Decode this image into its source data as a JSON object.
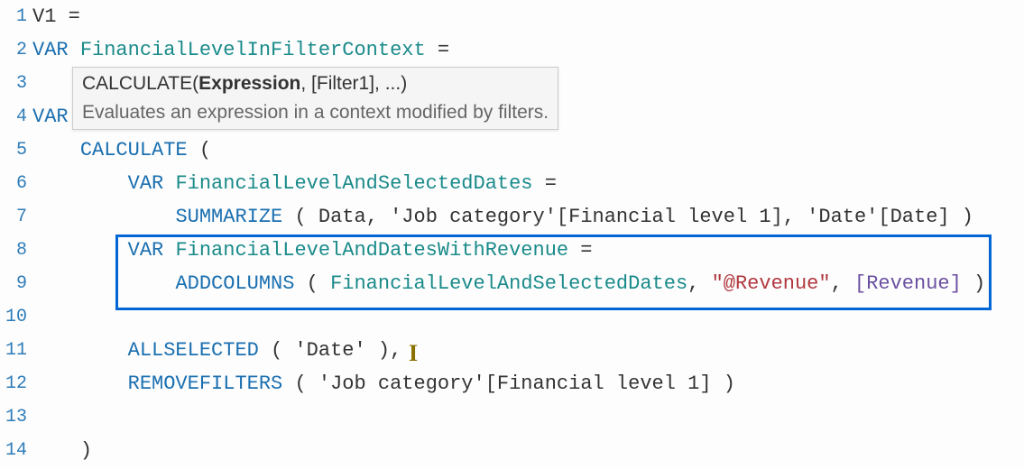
{
  "lines": {
    "l1_num": "1",
    "l1_name": "V1",
    "l1_eq": " =",
    "l2_num": "2",
    "l2_var": "VAR ",
    "l2_id": "FinancialLevelInFilterContext",
    "l2_eq": " =",
    "l3_num": "3",
    "l4_num": "4",
    "l4_var": "VAR ",
    "l5_num": "5",
    "l5_pad": "    ",
    "l5_func": "CALCULATE",
    "l5_paren": " (",
    "l6_num": "6",
    "l6_pad": "        ",
    "l6_var": "VAR ",
    "l6_id": "FinancialLevelAndSelectedDates",
    "l6_eq": " =",
    "l7_num": "7",
    "l7_pad": "            ",
    "l7_func": "SUMMARIZE",
    "l7_open": " ( ",
    "l7_arg1": "Data",
    "l7_c1": ", ",
    "l7_arg2": "'Job category'[Financial level 1]",
    "l7_c2": ", ",
    "l7_arg3": "'Date'[Date]",
    "l7_close": " )",
    "l8_num": "8",
    "l8_pad": "        ",
    "l8_var": "VAR ",
    "l8_id": "FinancialLevelAndDatesWithRevenue",
    "l8_eq": " =",
    "l9_num": "9",
    "l9_pad": "            ",
    "l9_func": "ADDCOLUMNS",
    "l9_open": " ( ",
    "l9_arg1": "FinancialLevelAndSelectedDates",
    "l9_c1": ", ",
    "l9_str": "\"@Revenue\"",
    "l9_c2": ", ",
    "l9_br_open": "[",
    "l9_meas": "Revenue",
    "l9_br_close": "]",
    "l9_close": " )",
    "l10_num": "10",
    "l11_num": "11",
    "l11_pad": "        ",
    "l11_func": "ALLSELECTED",
    "l11_open": " ( ",
    "l11_arg": "'Date'",
    "l11_close": " ),",
    "l12_num": "12",
    "l12_pad": "        ",
    "l12_func": "REMOVEFILTERS",
    "l12_open": " ( ",
    "l12_arg": "'Job category'[Financial level 1]",
    "l12_close": " )",
    "l13_num": "13",
    "l14_num": "14",
    "l14_pad": "    ",
    "l14_close": ")"
  },
  "tooltip": {
    "sig_func": "CALCULATE(",
    "sig_bold": "Expression",
    "sig_rest": ", [Filter1], ...)",
    "desc": "Evaluates an expression in a context modified by filters."
  },
  "caret": "I"
}
